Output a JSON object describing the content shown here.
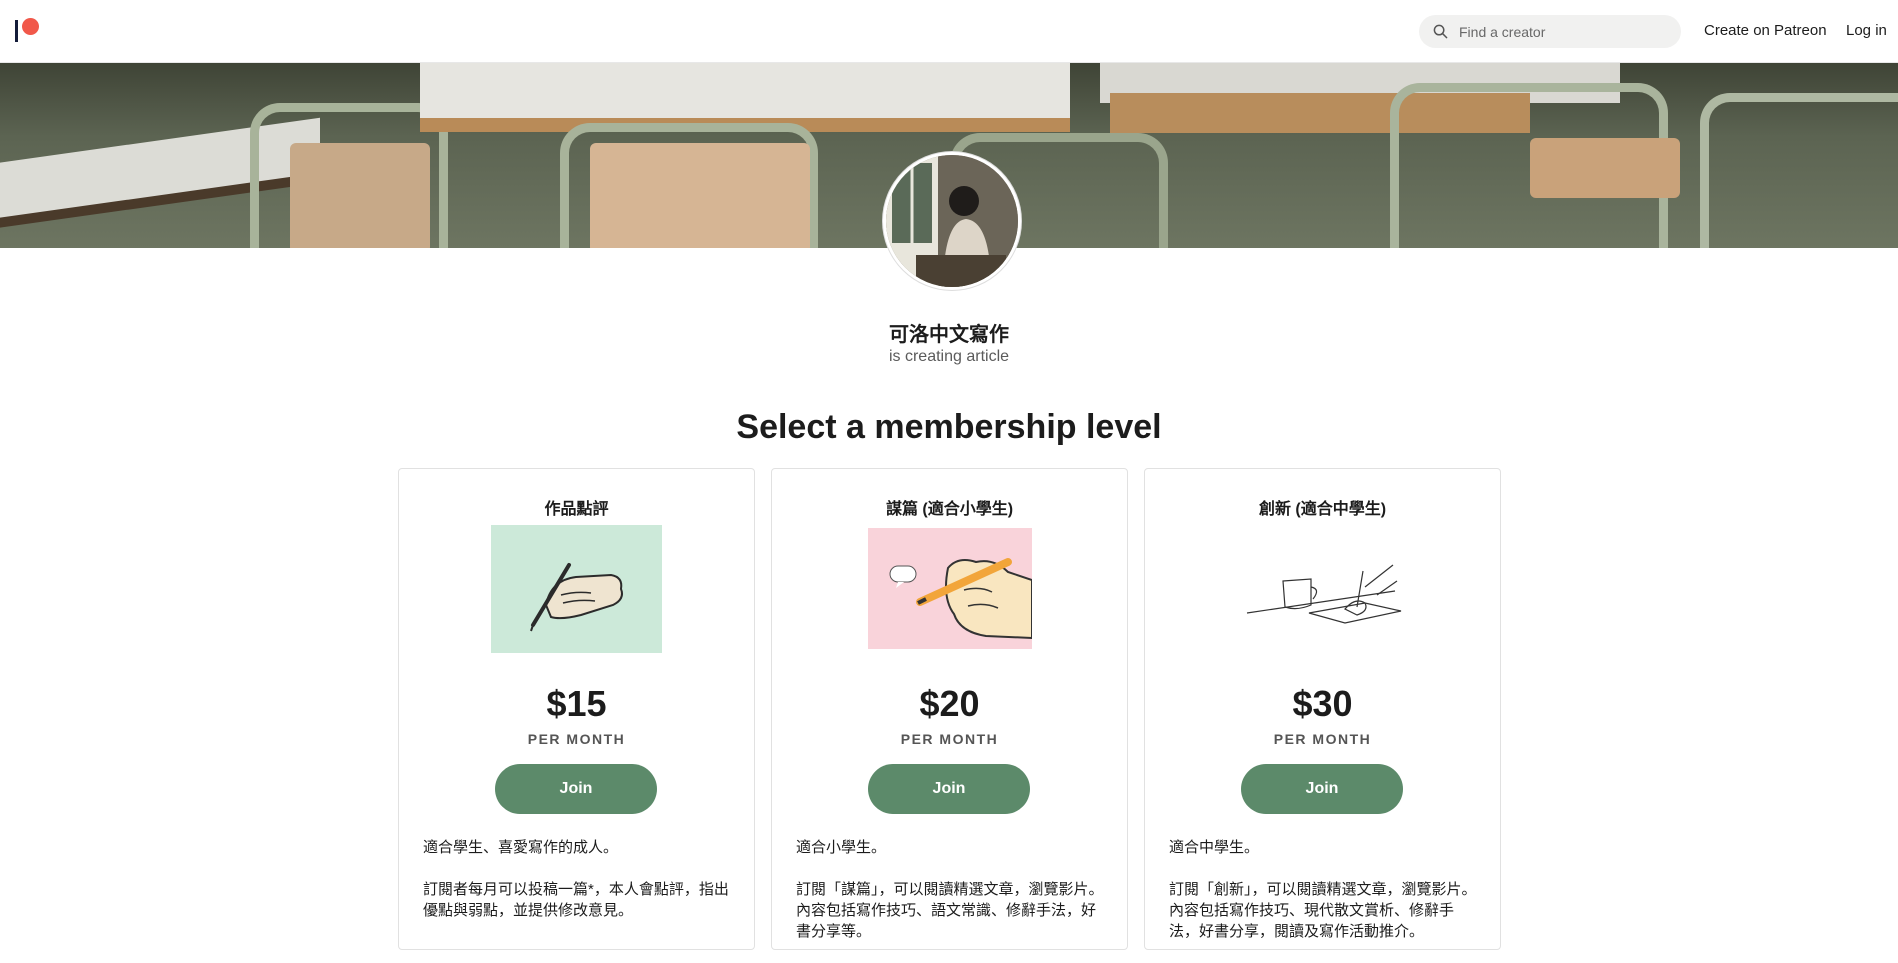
{
  "header": {
    "search_placeholder": "Find a creator",
    "create_link": "Create on Patreon",
    "login_link": "Log in"
  },
  "creator": {
    "name": "可洛中文寫作",
    "subtitle": "is creating article"
  },
  "page_heading": "Select a membership level",
  "tiers": [
    {
      "name": "作品點評",
      "price": "$15",
      "period": "PER MONTH",
      "join_label": "Join",
      "desc_intro": "適合學生、喜愛寫作的成人。",
      "desc_body": "訂閱者每月可以投稿一篇*，本人會點評，指出優點與弱點，並提供修改意見。"
    },
    {
      "name": "謀篇 (適合小學生)",
      "price": "$20",
      "period": "PER MONTH",
      "join_label": "Join",
      "desc_intro": "適合小學生。",
      "desc_body": "訂閱「謀篇」，可以閱讀精選文章，瀏覽影片。內容包括寫作技巧、語文常識、修辭手法，好書分享等。"
    },
    {
      "name": "創新 (適合中學生)",
      "price": "$30",
      "period": "PER MONTH",
      "join_label": "Join",
      "desc_intro": "適合中學生。",
      "desc_body": "訂閱「創新」，可以閱讀精選文章，瀏覽影片。內容包括寫作技巧、現代散文賞析、修辭手法，好書分享，閱讀及寫作活動推介。"
    }
  ],
  "colors": {
    "brand_coral": "#f1584a",
    "brand_navy": "#141c3a",
    "join_button": "#5c8a6a",
    "tier1_image_bg": "#cce9d9",
    "tier2_image_bg": "#f9d3da"
  },
  "icons": [
    "patreon-logo",
    "search-icon"
  ]
}
